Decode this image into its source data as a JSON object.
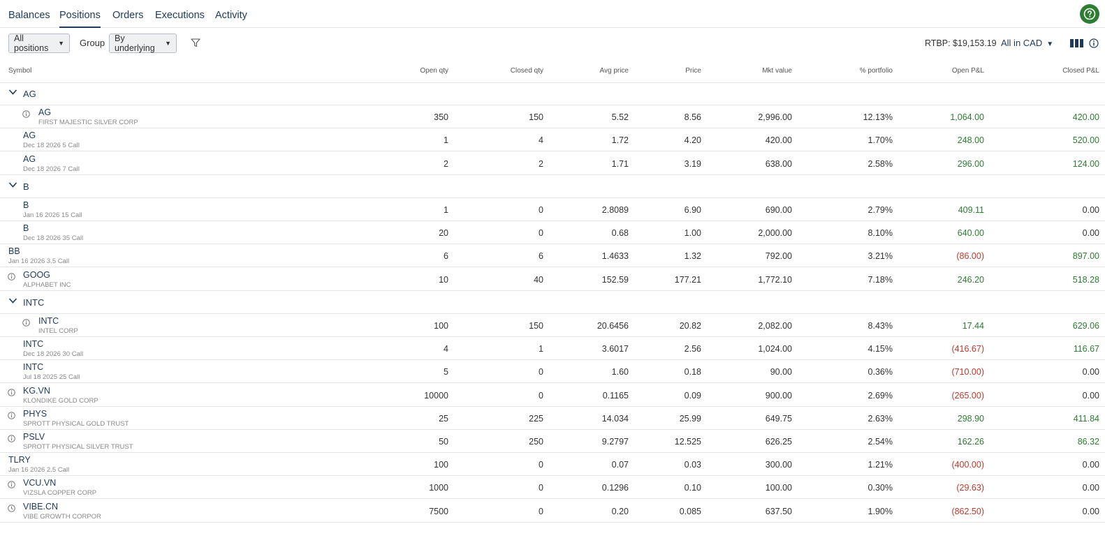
{
  "nav": {
    "tabs": [
      "Balances",
      "Positions",
      "Orders",
      "Executions",
      "Activity"
    ],
    "active": "Positions"
  },
  "toolbar": {
    "filter_value": "All positions",
    "group_label": "Group",
    "group_value": "By underlying",
    "rtbp": "RTBP: $19,153.19",
    "currency": "All in CAD"
  },
  "columns": [
    "Symbol",
    "Open qty",
    "Closed qty",
    "Avg price",
    "Price",
    "Mkt value",
    "% portfolio",
    "Open P&L",
    "Closed P&L"
  ],
  "rows": [
    {
      "type": "group",
      "name": "AG"
    },
    {
      "type": "pos",
      "indent": 2,
      "icon": "info-icon",
      "symbol": "AG",
      "desc": "FIRST MAJESTIC SILVER CORP",
      "open_qty": "350",
      "closed_qty": "150",
      "avg_price": "5.52",
      "price": "8.56",
      "mkt_value": "2,996.00",
      "pct": "12.13%",
      "open_pl": "1,064.00",
      "closed_pl": "420.00"
    },
    {
      "type": "pos",
      "indent": 1,
      "symbol": "AG",
      "desc": "Dec 18 2026 5 Call",
      "open_qty": "1",
      "closed_qty": "4",
      "avg_price": "1.72",
      "price": "4.20",
      "mkt_value": "420.00",
      "pct": "1.70%",
      "open_pl": "248.00",
      "closed_pl": "520.00"
    },
    {
      "type": "pos",
      "indent": 1,
      "symbol": "AG",
      "desc": "Dec 18 2026 7 Call",
      "open_qty": "2",
      "closed_qty": "2",
      "avg_price": "1.71",
      "price": "3.19",
      "mkt_value": "638.00",
      "pct": "2.58%",
      "open_pl": "296.00",
      "closed_pl": "124.00"
    },
    {
      "type": "group",
      "name": "B"
    },
    {
      "type": "pos",
      "indent": 1,
      "symbol": "B",
      "desc": "Jan 16 2026 15 Call",
      "open_qty": "1",
      "closed_qty": "0",
      "avg_price": "2.8089",
      "price": "6.90",
      "mkt_value": "690.00",
      "pct": "2.79%",
      "open_pl": "409.11",
      "closed_pl": "0.00"
    },
    {
      "type": "pos",
      "indent": 1,
      "symbol": "B",
      "desc": "Dec 18 2026 35 Call",
      "open_qty": "20",
      "closed_qty": "0",
      "avg_price": "0.68",
      "price": "1.00",
      "mkt_value": "2,000.00",
      "pct": "8.10%",
      "open_pl": "640.00",
      "closed_pl": "0.00"
    },
    {
      "type": "pos",
      "indent": 0,
      "symbol": "BB",
      "desc": "Jan 16 2026 3.5 Call",
      "open_qty": "6",
      "closed_qty": "6",
      "avg_price": "1.4633",
      "price": "1.32",
      "mkt_value": "792.00",
      "pct": "3.21%",
      "open_pl": "(86.00)",
      "closed_pl": "897.00"
    },
    {
      "type": "pos",
      "indent": 1,
      "icon": "info-icon",
      "symbol": "GOOG",
      "desc": "ALPHABET INC",
      "open_qty": "10",
      "closed_qty": "40",
      "avg_price": "152.59",
      "price": "177.21",
      "mkt_value": "1,772.10",
      "pct": "7.18%",
      "open_pl": "246.20",
      "closed_pl": "518.28"
    },
    {
      "type": "group",
      "name": "INTC"
    },
    {
      "type": "pos",
      "indent": 2,
      "icon": "info-icon",
      "symbol": "INTC",
      "desc": "INTEL CORP",
      "open_qty": "100",
      "closed_qty": "150",
      "avg_price": "20.6456",
      "price": "20.82",
      "mkt_value": "2,082.00",
      "pct": "8.43%",
      "open_pl": "17.44",
      "closed_pl": "629.06"
    },
    {
      "type": "pos",
      "indent": 1,
      "symbol": "INTC",
      "desc": "Dec 18 2026 30 Call",
      "open_qty": "4",
      "closed_qty": "1",
      "avg_price": "3.6017",
      "price": "2.56",
      "mkt_value": "1,024.00",
      "pct": "4.15%",
      "open_pl": "(416.67)",
      "closed_pl": "116.67"
    },
    {
      "type": "pos",
      "indent": 1,
      "symbol": "INTC",
      "desc": "Jul 18 2025 25 Call",
      "open_qty": "5",
      "closed_qty": "0",
      "avg_price": "1.60",
      "price": "0.18",
      "mkt_value": "90.00",
      "pct": "0.36%",
      "open_pl": "(710.00)",
      "closed_pl": "0.00"
    },
    {
      "type": "pos",
      "indent": 1,
      "icon": "info-icon",
      "symbol": "KG.VN",
      "desc": "KLONDIKE GOLD CORP",
      "open_qty": "10000",
      "closed_qty": "0",
      "avg_price": "0.1165",
      "price": "0.09",
      "mkt_value": "900.00",
      "pct": "2.69%",
      "open_pl": "(265.00)",
      "closed_pl": "0.00"
    },
    {
      "type": "pos",
      "indent": 1,
      "icon": "info-icon",
      "symbol": "PHYS",
      "desc": "SPROTT PHYSICAL GOLD TRUST",
      "open_qty": "25",
      "closed_qty": "225",
      "avg_price": "14.034",
      "price": "25.99",
      "mkt_value": "649.75",
      "pct": "2.63%",
      "open_pl": "298.90",
      "closed_pl": "411.84"
    },
    {
      "type": "pos",
      "indent": 1,
      "icon": "info-icon",
      "symbol": "PSLV",
      "desc": "SPROTT PHYSICAL SILVER TRUST",
      "open_qty": "50",
      "closed_qty": "250",
      "avg_price": "9.2797",
      "price": "12.525",
      "mkt_value": "626.25",
      "pct": "2.54%",
      "open_pl": "162.26",
      "closed_pl": "86.32"
    },
    {
      "type": "pos",
      "indent": 0,
      "symbol": "TLRY",
      "desc": "Jan 16 2026 2.5 Call",
      "open_qty": "100",
      "closed_qty": "0",
      "avg_price": "0.07",
      "price": "0.03",
      "mkt_value": "300.00",
      "pct": "1.21%",
      "open_pl": "(400.00)",
      "closed_pl": "0.00"
    },
    {
      "type": "pos",
      "indent": 1,
      "icon": "info-icon",
      "symbol": "VCU.VN",
      "desc": "VIZSLA COPPER CORP",
      "open_qty": "1000",
      "closed_qty": "0",
      "avg_price": "0.1296",
      "price": "0.10",
      "mkt_value": "100.00",
      "pct": "0.30%",
      "open_pl": "(29.63)",
      "closed_pl": "0.00"
    },
    {
      "type": "pos",
      "indent": 1,
      "icon": "clock-icon",
      "symbol": "VIBE.CN",
      "desc": "VIBE GROWTH CORPOR",
      "open_qty": "7500",
      "closed_qty": "0",
      "avg_price": "0.20",
      "price": "0.085",
      "mkt_value": "637.50",
      "pct": "1.90%",
      "open_pl": "(862.50)",
      "closed_pl": "0.00"
    }
  ],
  "colors": {
    "positive": "#2e7d32",
    "negative": "#c0392b",
    "link": "#1f3a5a"
  }
}
